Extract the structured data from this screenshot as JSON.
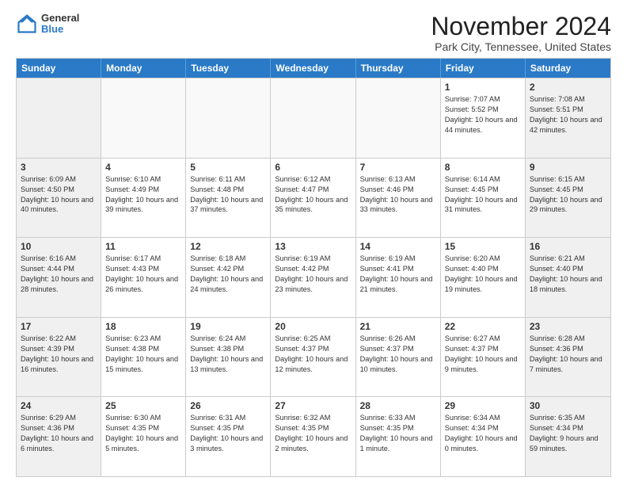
{
  "logo": {
    "general": "General",
    "blue": "Blue"
  },
  "header": {
    "title": "November 2024",
    "subtitle": "Park City, Tennessee, United States"
  },
  "weekdays": [
    "Sunday",
    "Monday",
    "Tuesday",
    "Wednesday",
    "Thursday",
    "Friday",
    "Saturday"
  ],
  "weeks": [
    [
      {
        "day": "",
        "info": ""
      },
      {
        "day": "",
        "info": ""
      },
      {
        "day": "",
        "info": ""
      },
      {
        "day": "",
        "info": ""
      },
      {
        "day": "",
        "info": ""
      },
      {
        "day": "1",
        "info": "Sunrise: 7:07 AM\nSunset: 5:52 PM\nDaylight: 10 hours and 44 minutes."
      },
      {
        "day": "2",
        "info": "Sunrise: 7:08 AM\nSunset: 5:51 PM\nDaylight: 10 hours and 42 minutes."
      }
    ],
    [
      {
        "day": "3",
        "info": "Sunrise: 6:09 AM\nSunset: 4:50 PM\nDaylight: 10 hours and 40 minutes."
      },
      {
        "day": "4",
        "info": "Sunrise: 6:10 AM\nSunset: 4:49 PM\nDaylight: 10 hours and 39 minutes."
      },
      {
        "day": "5",
        "info": "Sunrise: 6:11 AM\nSunset: 4:48 PM\nDaylight: 10 hours and 37 minutes."
      },
      {
        "day": "6",
        "info": "Sunrise: 6:12 AM\nSunset: 4:47 PM\nDaylight: 10 hours and 35 minutes."
      },
      {
        "day": "7",
        "info": "Sunrise: 6:13 AM\nSunset: 4:46 PM\nDaylight: 10 hours and 33 minutes."
      },
      {
        "day": "8",
        "info": "Sunrise: 6:14 AM\nSunset: 4:45 PM\nDaylight: 10 hours and 31 minutes."
      },
      {
        "day": "9",
        "info": "Sunrise: 6:15 AM\nSunset: 4:45 PM\nDaylight: 10 hours and 29 minutes."
      }
    ],
    [
      {
        "day": "10",
        "info": "Sunrise: 6:16 AM\nSunset: 4:44 PM\nDaylight: 10 hours and 28 minutes."
      },
      {
        "day": "11",
        "info": "Sunrise: 6:17 AM\nSunset: 4:43 PM\nDaylight: 10 hours and 26 minutes."
      },
      {
        "day": "12",
        "info": "Sunrise: 6:18 AM\nSunset: 4:42 PM\nDaylight: 10 hours and 24 minutes."
      },
      {
        "day": "13",
        "info": "Sunrise: 6:19 AM\nSunset: 4:42 PM\nDaylight: 10 hours and 23 minutes."
      },
      {
        "day": "14",
        "info": "Sunrise: 6:19 AM\nSunset: 4:41 PM\nDaylight: 10 hours and 21 minutes."
      },
      {
        "day": "15",
        "info": "Sunrise: 6:20 AM\nSunset: 4:40 PM\nDaylight: 10 hours and 19 minutes."
      },
      {
        "day": "16",
        "info": "Sunrise: 6:21 AM\nSunset: 4:40 PM\nDaylight: 10 hours and 18 minutes."
      }
    ],
    [
      {
        "day": "17",
        "info": "Sunrise: 6:22 AM\nSunset: 4:39 PM\nDaylight: 10 hours and 16 minutes."
      },
      {
        "day": "18",
        "info": "Sunrise: 6:23 AM\nSunset: 4:38 PM\nDaylight: 10 hours and 15 minutes."
      },
      {
        "day": "19",
        "info": "Sunrise: 6:24 AM\nSunset: 4:38 PM\nDaylight: 10 hours and 13 minutes."
      },
      {
        "day": "20",
        "info": "Sunrise: 6:25 AM\nSunset: 4:37 PM\nDaylight: 10 hours and 12 minutes."
      },
      {
        "day": "21",
        "info": "Sunrise: 6:26 AM\nSunset: 4:37 PM\nDaylight: 10 hours and 10 minutes."
      },
      {
        "day": "22",
        "info": "Sunrise: 6:27 AM\nSunset: 4:37 PM\nDaylight: 10 hours and 9 minutes."
      },
      {
        "day": "23",
        "info": "Sunrise: 6:28 AM\nSunset: 4:36 PM\nDaylight: 10 hours and 7 minutes."
      }
    ],
    [
      {
        "day": "24",
        "info": "Sunrise: 6:29 AM\nSunset: 4:36 PM\nDaylight: 10 hours and 6 minutes."
      },
      {
        "day": "25",
        "info": "Sunrise: 6:30 AM\nSunset: 4:35 PM\nDaylight: 10 hours and 5 minutes."
      },
      {
        "day": "26",
        "info": "Sunrise: 6:31 AM\nSunset: 4:35 PM\nDaylight: 10 hours and 3 minutes."
      },
      {
        "day": "27",
        "info": "Sunrise: 6:32 AM\nSunset: 4:35 PM\nDaylight: 10 hours and 2 minutes."
      },
      {
        "day": "28",
        "info": "Sunrise: 6:33 AM\nSunset: 4:35 PM\nDaylight: 10 hours and 1 minute."
      },
      {
        "day": "29",
        "info": "Sunrise: 6:34 AM\nSunset: 4:34 PM\nDaylight: 10 hours and 0 minutes."
      },
      {
        "day": "30",
        "info": "Sunrise: 6:35 AM\nSunset: 4:34 PM\nDaylight: 9 hours and 59 minutes."
      }
    ]
  ]
}
